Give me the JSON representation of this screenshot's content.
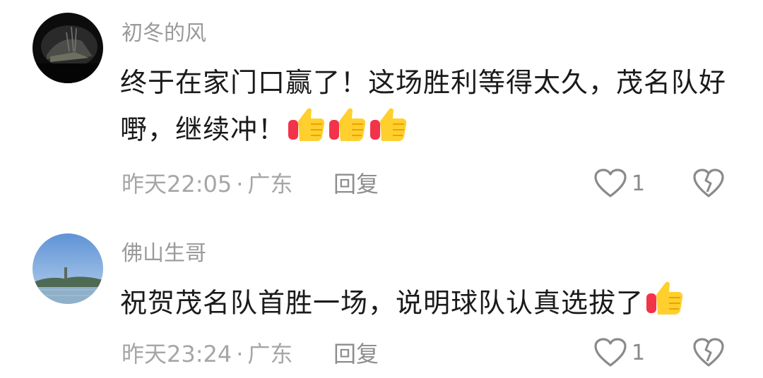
{
  "comments": [
    {
      "username": "初冬的风",
      "content": "终于在家门口赢了！这场胜利等得太久，茂名队好嘢，继续冲！",
      "emoji": "thumbs-up",
      "time": "昨天22:05",
      "dot": "·",
      "location": "广东",
      "reply_label": "回复",
      "likes": "1"
    },
    {
      "username": "佛山生哥",
      "content": "祝贺茂名队首胜一场，说明球队认真选拔了",
      "emoji": "thumbs-up",
      "time": "昨天23:24",
      "dot": "·",
      "location": "广东",
      "reply_label": "回复",
      "likes": "1"
    }
  ],
  "colors": {
    "text": "#1a1a1a",
    "meta": "#a6a6a6",
    "username": "#9a9a9a",
    "thumb_yellow": "#ffcf2e",
    "thumb_red": "#f2334a"
  },
  "icons": [
    "avatar-dark-tunnel",
    "avatar-lake-sky",
    "thumbs-up-emoji",
    "heart-outline-icon",
    "broken-heart-icon"
  ]
}
